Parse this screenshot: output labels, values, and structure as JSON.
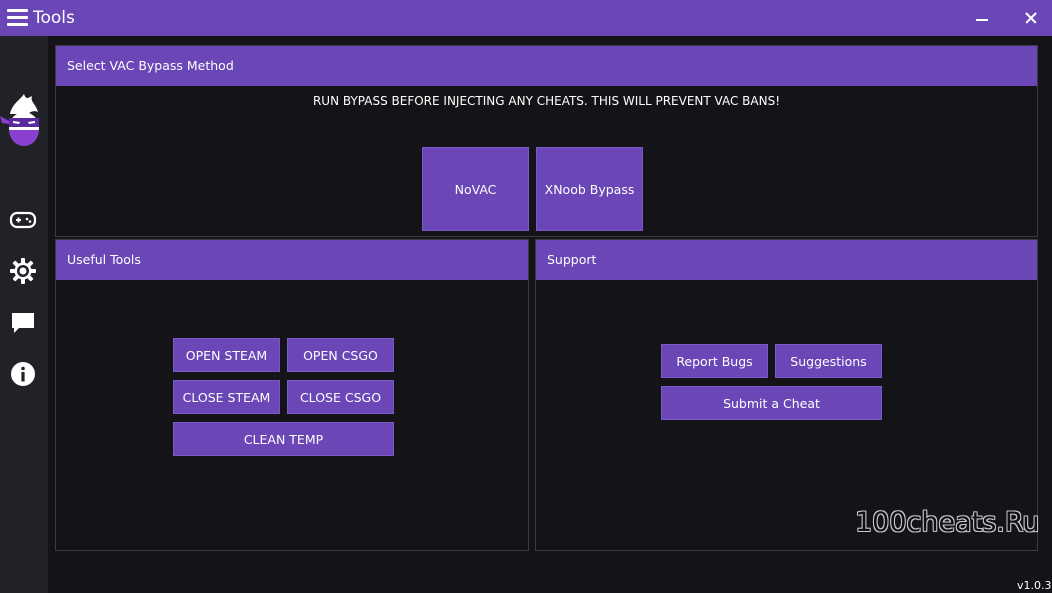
{
  "window": {
    "title": "Tools",
    "accent_color": "#6a46b7",
    "background_color": "#141418",
    "sidebar_color": "#202228"
  },
  "sidebar": {
    "items": [
      {
        "icon": "gamepad-icon"
      },
      {
        "icon": "gear-icon"
      },
      {
        "icon": "chat-icon"
      },
      {
        "icon": "info-icon"
      }
    ]
  },
  "vac_panel": {
    "header": "Select VAC Bypass Method",
    "notice": "RUN BYPASS BEFORE INJECTING ANY CHEATS. THIS WILL PREVENT VAC BANS!",
    "buttons": {
      "novac": "NoVAC",
      "xnoob": "XNoob Bypass"
    }
  },
  "tools_panel": {
    "header": "Useful Tools",
    "buttons": {
      "open_steam": "OPEN STEAM",
      "open_csgo": "OPEN CSGO",
      "close_steam": "CLOSE STEAM",
      "close_csgo": "CLOSE CSGO",
      "clean_temp": "CLEAN TEMP"
    }
  },
  "support_panel": {
    "header": "Support",
    "buttons": {
      "report_bugs": "Report Bugs",
      "suggestions": "Suggestions",
      "submit_cheat": "Submit a Cheat"
    }
  },
  "watermark": "100cheats.Ru",
  "version": "v1.0.3"
}
